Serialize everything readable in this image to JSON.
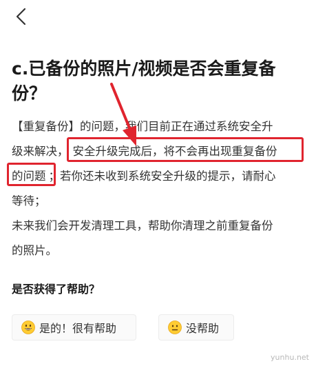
{
  "nav": {
    "back_icon": "chevron-left-icon"
  },
  "article": {
    "title": "c.已备份的照片/视频是否会重复备份？",
    "paragraph1_lines": [
      "【重复备份】的问题，我们目前正在通过系统安全升",
      "级来解决，",
      "安全升级完成后，将不会再出现重复备份",
      "的问题",
      "；若你还未收到系统安全升级的提示，请耐心",
      "等待；"
    ],
    "paragraph2_lines": [
      "未来我们会开发清理工具，帮助你清理之前重复备份",
      "的照片。"
    ]
  },
  "feedback": {
    "question": "是否获得了帮助？",
    "yes_label": "是的！很有帮助",
    "no_label": "没帮助",
    "yes_icon": "grinning-face-icon",
    "no_icon": "neutral-face-icon"
  },
  "annotation": {
    "highlight_color": "#e0242e"
  },
  "watermark": "yunhu.net"
}
